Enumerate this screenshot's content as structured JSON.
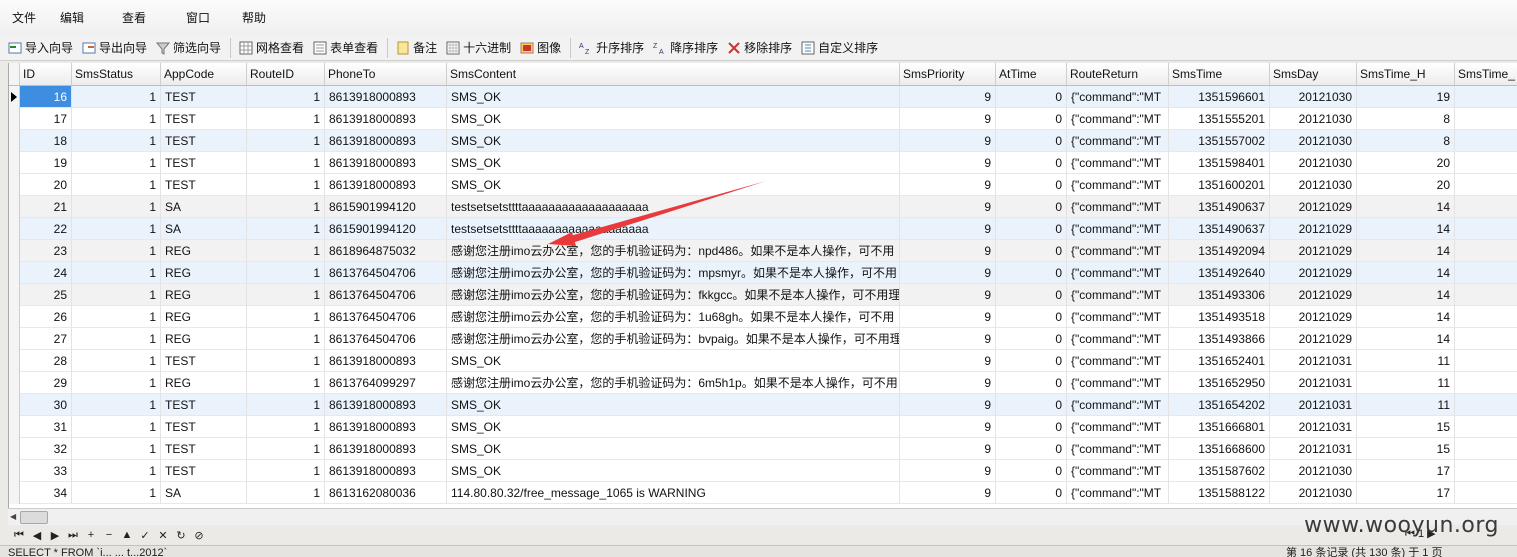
{
  "menu": [
    "文件",
    "编辑",
    "查看",
    "窗口",
    "帮助"
  ],
  "toolbar": [
    {
      "label": "导入向导",
      "icon": "import-icon"
    },
    {
      "label": "导出向导",
      "icon": "export-icon"
    },
    {
      "label": "筛选向导",
      "icon": "filter-icon"
    },
    {
      "label": "网格查看",
      "icon": "grid-icon"
    },
    {
      "label": "表单查看",
      "icon": "form-icon"
    },
    {
      "label": "备注",
      "icon": "note-icon"
    },
    {
      "label": "十六进制",
      "icon": "hex-icon"
    },
    {
      "label": "图像",
      "icon": "image-icon"
    },
    {
      "label": "升序排序",
      "icon": "sort-asc-icon"
    },
    {
      "label": "降序排序",
      "icon": "sort-desc-icon"
    },
    {
      "label": "移除排序",
      "icon": "remove-sort-icon"
    },
    {
      "label": "自定义排序",
      "icon": "custom-sort-icon"
    }
  ],
  "columns": [
    "ID",
    "SmsStatus",
    "AppCode",
    "RouteID",
    "PhoneTo",
    "SmsContent",
    "SmsPriority",
    "AtTime",
    "RouteReturn",
    "SmsTime",
    "SmsDay",
    "SmsTime_H",
    "SmsTime_"
  ],
  "rows": [
    [
      "16",
      "1",
      "TEST",
      "1",
      "8613918000893",
      "SMS_OK",
      "9",
      "0",
      "{\"command\":\"MT",
      "1351596601",
      "20121030",
      "19"
    ],
    [
      "17",
      "1",
      "TEST",
      "1",
      "8613918000893",
      "SMS_OK",
      "9",
      "0",
      "{\"command\":\"MT",
      "1351555201",
      "20121030",
      "8"
    ],
    [
      "18",
      "1",
      "TEST",
      "1",
      "8613918000893",
      "SMS_OK",
      "9",
      "0",
      "{\"command\":\"MT",
      "1351557002",
      "20121030",
      "8"
    ],
    [
      "19",
      "1",
      "TEST",
      "1",
      "8613918000893",
      "SMS_OK",
      "9",
      "0",
      "{\"command\":\"MT",
      "1351598401",
      "20121030",
      "20"
    ],
    [
      "20",
      "1",
      "TEST",
      "1",
      "8613918000893",
      "SMS_OK",
      "9",
      "0",
      "{\"command\":\"MT",
      "1351600201",
      "20121030",
      "20"
    ],
    [
      "21",
      "1",
      "SA",
      "1",
      "8615901994120",
      "testsetsetsttttaaaaaaaaaaaaaaaaaaa",
      "9",
      "0",
      "{\"command\":\"MT",
      "1351490637",
      "20121029",
      "14"
    ],
    [
      "22",
      "1",
      "SA",
      "1",
      "8615901994120",
      "testsetsetsttttaaaaaaaaaaaaaaaaaaa",
      "9",
      "0",
      "{\"command\":\"MT",
      "1351490637",
      "20121029",
      "14"
    ],
    [
      "23",
      "1",
      "REG",
      "1",
      "8618964875032",
      "感谢您注册imo云办公室，您的手机验证码为：npd486。如果不是本人操作，可不用",
      "9",
      "0",
      "{\"command\":\"MT",
      "1351492094",
      "20121029",
      "14"
    ],
    [
      "24",
      "1",
      "REG",
      "1",
      "8613764504706",
      "感谢您注册imo云办公室，您的手机验证码为：mpsmyr。如果不是本人操作，可不用",
      "9",
      "0",
      "{\"command\":\"MT",
      "1351492640",
      "20121029",
      "14"
    ],
    [
      "25",
      "1",
      "REG",
      "1",
      "8613764504706",
      "感谢您注册imo云办公室，您的手机验证码为：fkkgcc。如果不是本人操作，可不用理",
      "9",
      "0",
      "{\"command\":\"MT",
      "1351493306",
      "20121029",
      "14"
    ],
    [
      "26",
      "1",
      "REG",
      "1",
      "8613764504706",
      "感谢您注册imo云办公室，您的手机验证码为：1u68gh。如果不是本人操作，可不用",
      "9",
      "0",
      "{\"command\":\"MT",
      "1351493518",
      "20121029",
      "14"
    ],
    [
      "27",
      "1",
      "REG",
      "1",
      "8613764504706",
      "感谢您注册imo云办公室，您的手机验证码为：bvpaig。如果不是本人操作，可不用理",
      "9",
      "0",
      "{\"command\":\"MT",
      "1351493866",
      "20121029",
      "14"
    ],
    [
      "28",
      "1",
      "TEST",
      "1",
      "8613918000893",
      "SMS_OK",
      "9",
      "0",
      "{\"command\":\"MT",
      "1351652401",
      "20121031",
      "11"
    ],
    [
      "29",
      "1",
      "REG",
      "1",
      "8613764099297",
      "感谢您注册imo云办公室，您的手机验证码为：6m5h1p。如果不是本人操作，可不用",
      "9",
      "0",
      "{\"command\":\"MT",
      "1351652950",
      "20121031",
      "11"
    ],
    [
      "30",
      "1",
      "TEST",
      "1",
      "8613918000893",
      "SMS_OK",
      "9",
      "0",
      "{\"command\":\"MT",
      "1351654202",
      "20121031",
      "11"
    ],
    [
      "31",
      "1",
      "TEST",
      "1",
      "8613918000893",
      "SMS_OK",
      "9",
      "0",
      "{\"command\":\"MT",
      "1351666801",
      "20121031",
      "15"
    ],
    [
      "32",
      "1",
      "TEST",
      "1",
      "8613918000893",
      "SMS_OK",
      "9",
      "0",
      "{\"command\":\"MT",
      "1351668600",
      "20121031",
      "15"
    ],
    [
      "33",
      "1",
      "TEST",
      "1",
      "8613918000893",
      "SMS_OK",
      "9",
      "0",
      "{\"command\":\"MT",
      "1351587602",
      "20121030",
      "17"
    ],
    [
      "34",
      "1",
      "SA",
      "1",
      "8613162080036",
      "114.80.80.32/free_message_1065 is WARNING",
      "9",
      "0",
      "{\"command\":\"MT",
      "1351588122",
      "20121030",
      "17"
    ]
  ],
  "nav_buttons": [
    "⏮",
    "◀",
    "▶",
    "⏭",
    "+",
    "−",
    "▲",
    "✓",
    "✕",
    "↻",
    "⊘"
  ],
  "status_left": "SELECT * FROM `i... ... t...2012`",
  "status_right": "第 16 条记录 (共 130 条) 于 1 页",
  "pager": "1",
  "watermark": "www.wooyun.org",
  "colors": {
    "selected_id": "#3d8ee0",
    "alt_row": "#eaf3fc",
    "row": "#ffffff",
    "arrow": "#e83a3a"
  }
}
